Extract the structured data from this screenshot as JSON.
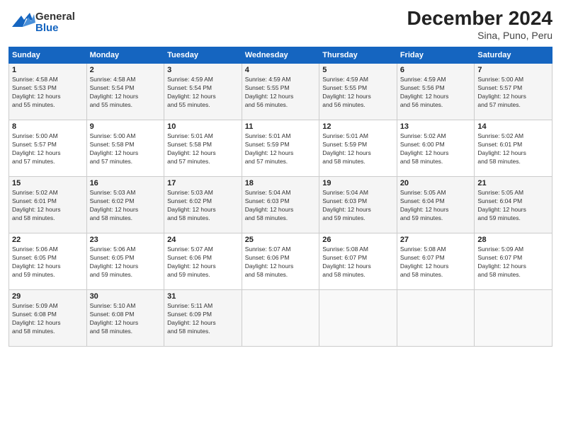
{
  "header": {
    "logo_general": "General",
    "logo_blue": "Blue",
    "month_title": "December 2024",
    "subtitle": "Sina, Puno, Peru"
  },
  "days_of_week": [
    "Sunday",
    "Monday",
    "Tuesday",
    "Wednesday",
    "Thursday",
    "Friday",
    "Saturday"
  ],
  "weeks": [
    [
      {
        "day": "1",
        "info": "Sunrise: 4:58 AM\nSunset: 5:53 PM\nDaylight: 12 hours\nand 55 minutes."
      },
      {
        "day": "2",
        "info": "Sunrise: 4:58 AM\nSunset: 5:54 PM\nDaylight: 12 hours\nand 55 minutes."
      },
      {
        "day": "3",
        "info": "Sunrise: 4:59 AM\nSunset: 5:54 PM\nDaylight: 12 hours\nand 55 minutes."
      },
      {
        "day": "4",
        "info": "Sunrise: 4:59 AM\nSunset: 5:55 PM\nDaylight: 12 hours\nand 56 minutes."
      },
      {
        "day": "5",
        "info": "Sunrise: 4:59 AM\nSunset: 5:55 PM\nDaylight: 12 hours\nand 56 minutes."
      },
      {
        "day": "6",
        "info": "Sunrise: 4:59 AM\nSunset: 5:56 PM\nDaylight: 12 hours\nand 56 minutes."
      },
      {
        "day": "7",
        "info": "Sunrise: 5:00 AM\nSunset: 5:57 PM\nDaylight: 12 hours\nand 57 minutes."
      }
    ],
    [
      {
        "day": "8",
        "info": "Sunrise: 5:00 AM\nSunset: 5:57 PM\nDaylight: 12 hours\nand 57 minutes."
      },
      {
        "day": "9",
        "info": "Sunrise: 5:00 AM\nSunset: 5:58 PM\nDaylight: 12 hours\nand 57 minutes."
      },
      {
        "day": "10",
        "info": "Sunrise: 5:01 AM\nSunset: 5:58 PM\nDaylight: 12 hours\nand 57 minutes."
      },
      {
        "day": "11",
        "info": "Sunrise: 5:01 AM\nSunset: 5:59 PM\nDaylight: 12 hours\nand 57 minutes."
      },
      {
        "day": "12",
        "info": "Sunrise: 5:01 AM\nSunset: 5:59 PM\nDaylight: 12 hours\nand 58 minutes."
      },
      {
        "day": "13",
        "info": "Sunrise: 5:02 AM\nSunset: 6:00 PM\nDaylight: 12 hours\nand 58 minutes."
      },
      {
        "day": "14",
        "info": "Sunrise: 5:02 AM\nSunset: 6:01 PM\nDaylight: 12 hours\nand 58 minutes."
      }
    ],
    [
      {
        "day": "15",
        "info": "Sunrise: 5:02 AM\nSunset: 6:01 PM\nDaylight: 12 hours\nand 58 minutes."
      },
      {
        "day": "16",
        "info": "Sunrise: 5:03 AM\nSunset: 6:02 PM\nDaylight: 12 hours\nand 58 minutes."
      },
      {
        "day": "17",
        "info": "Sunrise: 5:03 AM\nSunset: 6:02 PM\nDaylight: 12 hours\nand 58 minutes."
      },
      {
        "day": "18",
        "info": "Sunrise: 5:04 AM\nSunset: 6:03 PM\nDaylight: 12 hours\nand 58 minutes."
      },
      {
        "day": "19",
        "info": "Sunrise: 5:04 AM\nSunset: 6:03 PM\nDaylight: 12 hours\nand 59 minutes."
      },
      {
        "day": "20",
        "info": "Sunrise: 5:05 AM\nSunset: 6:04 PM\nDaylight: 12 hours\nand 59 minutes."
      },
      {
        "day": "21",
        "info": "Sunrise: 5:05 AM\nSunset: 6:04 PM\nDaylight: 12 hours\nand 59 minutes."
      }
    ],
    [
      {
        "day": "22",
        "info": "Sunrise: 5:06 AM\nSunset: 6:05 PM\nDaylight: 12 hours\nand 59 minutes."
      },
      {
        "day": "23",
        "info": "Sunrise: 5:06 AM\nSunset: 6:05 PM\nDaylight: 12 hours\nand 59 minutes."
      },
      {
        "day": "24",
        "info": "Sunrise: 5:07 AM\nSunset: 6:06 PM\nDaylight: 12 hours\nand 59 minutes."
      },
      {
        "day": "25",
        "info": "Sunrise: 5:07 AM\nSunset: 6:06 PM\nDaylight: 12 hours\nand 58 minutes."
      },
      {
        "day": "26",
        "info": "Sunrise: 5:08 AM\nSunset: 6:07 PM\nDaylight: 12 hours\nand 58 minutes."
      },
      {
        "day": "27",
        "info": "Sunrise: 5:08 AM\nSunset: 6:07 PM\nDaylight: 12 hours\nand 58 minutes."
      },
      {
        "day": "28",
        "info": "Sunrise: 5:09 AM\nSunset: 6:07 PM\nDaylight: 12 hours\nand 58 minutes."
      }
    ],
    [
      {
        "day": "29",
        "info": "Sunrise: 5:09 AM\nSunset: 6:08 PM\nDaylight: 12 hours\nand 58 minutes."
      },
      {
        "day": "30",
        "info": "Sunrise: 5:10 AM\nSunset: 6:08 PM\nDaylight: 12 hours\nand 58 minutes."
      },
      {
        "day": "31",
        "info": "Sunrise: 5:11 AM\nSunset: 6:09 PM\nDaylight: 12 hours\nand 58 minutes."
      },
      {
        "day": "",
        "info": ""
      },
      {
        "day": "",
        "info": ""
      },
      {
        "day": "",
        "info": ""
      },
      {
        "day": "",
        "info": ""
      }
    ]
  ]
}
